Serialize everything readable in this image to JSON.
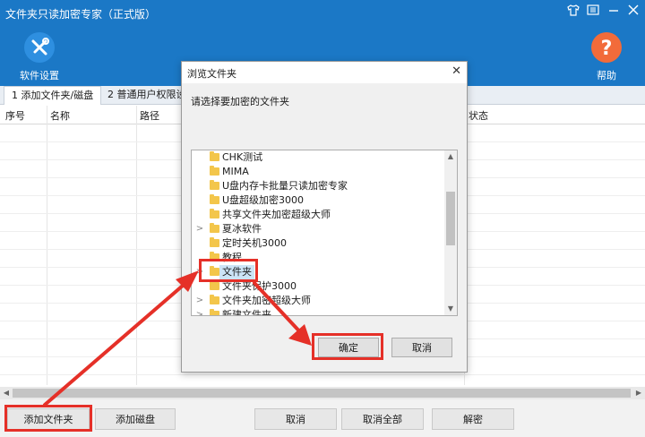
{
  "app": {
    "title": "文件夹只读加密专家（正式版）",
    "window_controls": {
      "skin": "skin-icon",
      "menu": "menu-icon",
      "minimize": "minimize-icon",
      "close": "close-icon"
    }
  },
  "toolbar": {
    "settings_label": "软件设置",
    "settings_icon": "wrench-screwdriver-icon",
    "help_label": "帮助",
    "help_icon": "question-icon",
    "settings_color": "#2e8fe0",
    "help_color": "#f26b3a"
  },
  "tabs": [
    {
      "label": "1 添加文件夹/磁盘",
      "active": true
    },
    {
      "label": "2 普通用户权限设"
    }
  ],
  "grid": {
    "columns": [
      "序号",
      "名称",
      "路径",
      "状态"
    ]
  },
  "buttons": {
    "add_folder": "添加文件夹",
    "add_disk": "添加磁盘",
    "cancel": "取消",
    "cancel_all": "取消全部",
    "decrypt": "解密"
  },
  "dialog": {
    "title": "浏览文件夹",
    "prompt": "请选择要加密的文件夹",
    "ok": "确定",
    "cancel": "取消",
    "tree": [
      {
        "label": "CHK测试",
        "expandable": false
      },
      {
        "label": "MIMA",
        "expandable": false
      },
      {
        "label": "U盘内存卡批量只读加密专家",
        "expandable": false
      },
      {
        "label": "U盘超级加密3000",
        "expandable": false
      },
      {
        "label": "共享文件夹加密超级大师",
        "expandable": false
      },
      {
        "label": "夏冰软件",
        "expandable": true
      },
      {
        "label": "定时关机3000",
        "expandable": false
      },
      {
        "label": "教程",
        "expandable": false
      },
      {
        "label": "文件夹",
        "expandable": true,
        "selected": true
      },
      {
        "label": "文件夹保护3000",
        "expandable": false
      },
      {
        "label": "文件夹加密超级大师",
        "expandable": true
      },
      {
        "label": "新建文件夹",
        "expandable": true
      }
    ]
  },
  "annotation_color": "#e53028"
}
